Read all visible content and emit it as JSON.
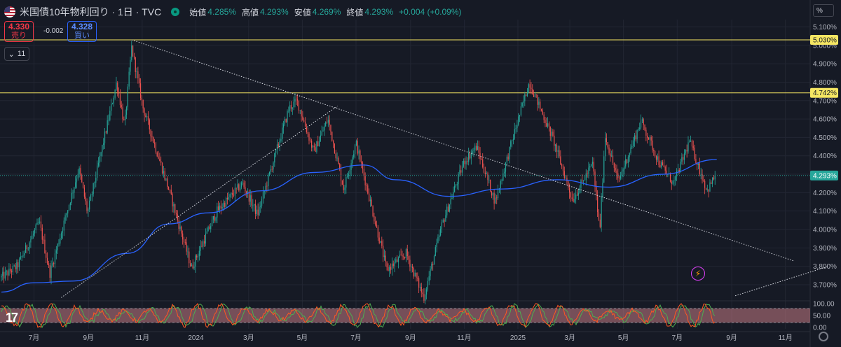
{
  "header": {
    "title": "米国債10年物利回り · 1日 · TVC",
    "open_label": "始値",
    "open": "4.285%",
    "high_label": "高値",
    "high": "4.293%",
    "low_label": "安値",
    "low": "4.269%",
    "close_label": "終値",
    "close": "4.293%",
    "change": "+0.004 (+0.09%)"
  },
  "trade": {
    "sell_price": "4.330",
    "sell_label": "売り",
    "spread": "-0.002",
    "buy_price": "4.328",
    "buy_label": "買い"
  },
  "indicators_collapsed_count": "11",
  "unit_button": "%",
  "chart_data": {
    "type": "candlestick",
    "y_axis_ticks": [
      "5.100%",
      "5.000%",
      "4.900%",
      "4.800%",
      "4.700%",
      "4.600%",
      "4.500%",
      "4.400%",
      "4.300%",
      "4.200%",
      "4.100%",
      "4.000%",
      "3.900%",
      "3.800%",
      "3.700%"
    ],
    "y_values": [
      5.1,
      5.0,
      4.9,
      4.8,
      4.7,
      4.6,
      4.5,
      4.4,
      4.3,
      4.2,
      4.1,
      4.0,
      3.9,
      3.8,
      3.7
    ],
    "ylim": [
      3.62,
      5.14
    ],
    "x_axis_ticks": [
      "7月",
      "9月",
      "11月",
      "2024",
      "3月",
      "5月",
      "7月",
      "9月",
      "11月",
      "2025",
      "3月",
      "5月",
      "7月",
      "9月",
      "11月"
    ],
    "price_labels": [
      {
        "value": 5.03,
        "text": "5.030%",
        "color": "#f5e663"
      },
      {
        "value": 4.742,
        "text": "4.742%",
        "color": "#f5e663"
      },
      {
        "value": 4.293,
        "text": "4.293%",
        "color": "#26a69a"
      }
    ],
    "horizontal_lines": [
      5.03,
      4.742
    ],
    "last_price": 4.293,
    "price_path_keyframes": [
      {
        "date": "2023-05-25",
        "value": 3.74
      },
      {
        "date": "2023-06-12",
        "value": 3.8
      },
      {
        "date": "2023-07-07",
        "value": 4.04
      },
      {
        "date": "2023-07-19",
        "value": 3.76
      },
      {
        "date": "2023-08-21",
        "value": 4.33
      },
      {
        "date": "2023-08-31",
        "value": 4.09
      },
      {
        "date": "2023-10-03",
        "value": 4.8
      },
      {
        "date": "2023-10-12",
        "value": 4.56
      },
      {
        "date": "2023-10-20",
        "value": 4.99
      },
      {
        "date": "2023-11-02",
        "value": 4.66
      },
      {
        "date": "2023-12-01",
        "value": 4.22
      },
      {
        "date": "2023-12-27",
        "value": 3.79
      },
      {
        "date": "2024-01-25",
        "value": 4.1
      },
      {
        "date": "2024-02-23",
        "value": 4.25
      },
      {
        "date": "2024-03-11",
        "value": 4.08
      },
      {
        "date": "2024-04-16",
        "value": 4.66
      },
      {
        "date": "2024-04-25",
        "value": 4.7
      },
      {
        "date": "2024-05-14",
        "value": 4.42
      },
      {
        "date": "2024-05-30",
        "value": 4.6
      },
      {
        "date": "2024-06-17",
        "value": 4.22
      },
      {
        "date": "2024-07-01",
        "value": 4.47
      },
      {
        "date": "2024-08-05",
        "value": 3.78
      },
      {
        "date": "2024-08-27",
        "value": 3.87
      },
      {
        "date": "2024-09-16",
        "value": 3.63
      },
      {
        "date": "2024-10-07",
        "value": 4.03
      },
      {
        "date": "2024-11-01",
        "value": 4.37
      },
      {
        "date": "2024-11-15",
        "value": 4.45
      },
      {
        "date": "2024-12-06",
        "value": 4.15
      },
      {
        "date": "2024-12-30",
        "value": 4.56
      },
      {
        "date": "2025-01-14",
        "value": 4.8
      },
      {
        "date": "2025-02-10",
        "value": 4.49
      },
      {
        "date": "2025-03-04",
        "value": 4.16
      },
      {
        "date": "2025-03-27",
        "value": 4.36
      },
      {
        "date": "2025-04-04",
        "value": 3.99
      },
      {
        "date": "2025-04-10",
        "value": 4.51
      },
      {
        "date": "2025-04-25",
        "value": 4.26
      },
      {
        "date": "2025-05-21",
        "value": 4.59
      },
      {
        "date": "2025-06-11",
        "value": 4.36
      },
      {
        "date": "2025-06-27",
        "value": 4.25
      },
      {
        "date": "2025-07-15",
        "value": 4.48
      },
      {
        "date": "2025-08-04",
        "value": 4.21
      },
      {
        "date": "2025-08-13",
        "value": 4.29
      }
    ],
    "moving_average_keyframes": [
      {
        "date": "2023-05-25",
        "value": 3.66
      },
      {
        "date": "2023-06-30",
        "value": 3.71
      },
      {
        "date": "2023-08-15",
        "value": 3.72
      },
      {
        "date": "2023-10-15",
        "value": 3.87
      },
      {
        "date": "2023-12-01",
        "value": 4.03
      },
      {
        "date": "2024-01-15",
        "value": 4.09
      },
      {
        "date": "2024-03-15",
        "value": 4.21
      },
      {
        "date": "2024-05-15",
        "value": 4.31
      },
      {
        "date": "2024-07-10",
        "value": 4.35
      },
      {
        "date": "2024-08-15",
        "value": 4.27
      },
      {
        "date": "2024-10-15",
        "value": 4.18
      },
      {
        "date": "2024-12-15",
        "value": 4.22
      },
      {
        "date": "2025-02-15",
        "value": 4.27
      },
      {
        "date": "2025-04-15",
        "value": 4.23
      },
      {
        "date": "2025-06-15",
        "value": 4.3
      },
      {
        "date": "2025-08-15",
        "value": 4.38
      }
    ],
    "trendlines": [
      {
        "from": {
          "date": "2023-10-20",
          "value": 5.03
        },
        "to": {
          "date": "2025-11-10",
          "value": 3.83
        }
      },
      {
        "from": {
          "date": "2023-08-01",
          "value": 3.63
        },
        "to": {
          "date": "2024-06-10",
          "value": 4.67
        }
      },
      {
        "from": {
          "date": "2025-09-05",
          "value": 3.64
        },
        "to": {
          "date": "2025-12-20",
          "value": 3.8
        }
      }
    ],
    "oscillator": {
      "y_axis_ticks": [
        "100.00",
        "50.00",
        "0.00"
      ],
      "ylim": [
        0,
        100
      ],
      "band": [
        20,
        80
      ],
      "series": [
        {
          "color": "#4caf50"
        },
        {
          "color": "#ff5722"
        }
      ]
    },
    "colors": {
      "up": "#26a69a",
      "down": "#ef5350",
      "ma": "#2962ff",
      "level": "#f5e663"
    },
    "grid": true
  }
}
